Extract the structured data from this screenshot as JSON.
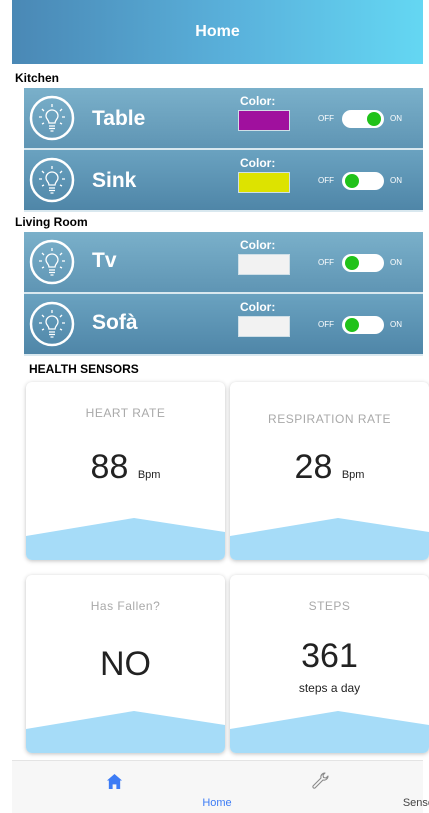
{
  "header": {
    "title": "Home"
  },
  "rooms": [
    {
      "name": "Kitchen",
      "lights": [
        {
          "name": "Table",
          "color_label": "Color:",
          "color": "#a0109e",
          "off_label": "OFF",
          "on_label": "ON",
          "state": "on"
        },
        {
          "name": "Sink",
          "color_label": "Color:",
          "color": "#dde300",
          "off_label": "OFF",
          "on_label": "ON",
          "state": "off"
        }
      ]
    },
    {
      "name": "Living Room",
      "lights": [
        {
          "name": "Tv",
          "color_label": "Color:",
          "color": "#f2f2f2",
          "off_label": "OFF",
          "on_label": "ON",
          "state": "off"
        },
        {
          "name": "Sofà",
          "color_label": "Color:",
          "color": "#f2f2f2",
          "off_label": "OFF",
          "on_label": "ON",
          "state": "off"
        }
      ]
    }
  ],
  "health": {
    "title": "HEALTH SENSORS",
    "cards": [
      {
        "label": "HEART RATE",
        "value": "88",
        "unit": "Bpm"
      },
      {
        "label": "RESPIRATION RATE",
        "value": "28",
        "unit": "Bpm"
      },
      {
        "label": "Has Fallen?",
        "value": "NO"
      },
      {
        "label": "STEPS",
        "value": "361",
        "unit": "steps a day"
      }
    ]
  },
  "tabs": [
    {
      "label": "Home",
      "icon": "home-icon",
      "active": true
    },
    {
      "label": "Sensors",
      "icon": "wrench-icon",
      "active": false
    }
  ],
  "colors": {
    "accent": "#3d7cf5",
    "toggle_knob": "#21c21a",
    "wave": "#a6dcf8"
  }
}
